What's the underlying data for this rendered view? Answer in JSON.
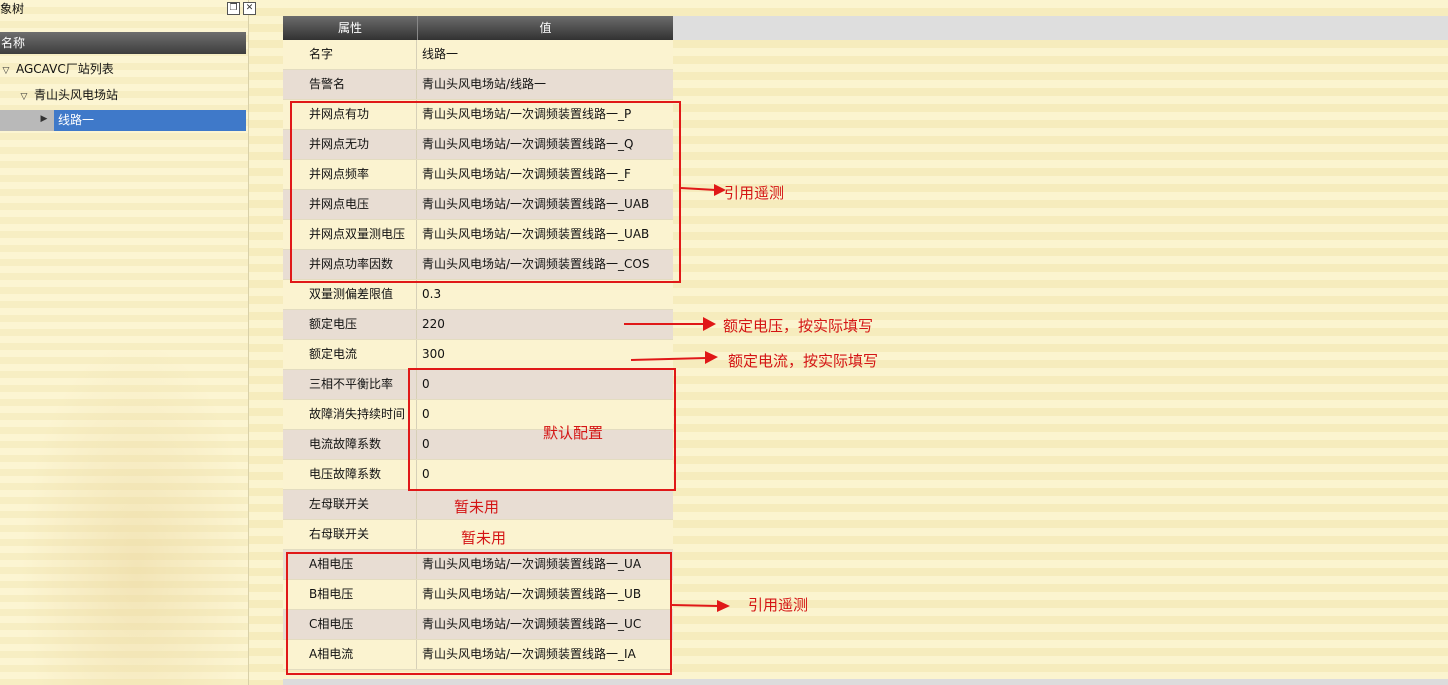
{
  "left_panel": {
    "title": "象树",
    "column_header": "名称",
    "tree": [
      {
        "label": "AGCAVC厂站列表",
        "expanded": true
      },
      {
        "label": "青山头风电场站",
        "expanded": true
      },
      {
        "label": "线路一",
        "selected": true
      }
    ]
  },
  "table": {
    "headers": [
      "属性",
      "值"
    ],
    "rows": [
      {
        "name": "名字",
        "value": "线路一"
      },
      {
        "name": "告警名",
        "value": "青山头风电场站/线路一"
      },
      {
        "name": "并网点有功",
        "value": "青山头风电场站/一次调频装置线路一_P"
      },
      {
        "name": "并网点无功",
        "value": "青山头风电场站/一次调频装置线路一_Q"
      },
      {
        "name": "并网点频率",
        "value": "青山头风电场站/一次调频装置线路一_F"
      },
      {
        "name": "并网点电压",
        "value": "青山头风电场站/一次调频装置线路一_UAB"
      },
      {
        "name": "并网点双量测电压",
        "value": "青山头风电场站/一次调频装置线路一_UAB"
      },
      {
        "name": "并网点功率因数",
        "value": "青山头风电场站/一次调频装置线路一_COS"
      },
      {
        "name": "双量测偏差限值",
        "value": "0.3"
      },
      {
        "name": "额定电压",
        "value": "220"
      },
      {
        "name": "额定电流",
        "value": "300"
      },
      {
        "name": "三相不平衡比率",
        "value": "0"
      },
      {
        "name": "故障消失持续时间",
        "value": "0"
      },
      {
        "name": "电流故障系数",
        "value": "0"
      },
      {
        "name": "电压故障系数",
        "value": "0"
      },
      {
        "name": "左母联开关",
        "value": ""
      },
      {
        "name": "右母联开关",
        "value": ""
      },
      {
        "name": "A相电压",
        "value": "青山头风电场站/一次调频装置线路一_UA"
      },
      {
        "name": "B相电压",
        "value": "青山头风电场站/一次调频装置线路一_UB"
      },
      {
        "name": "C相电压",
        "value": "青山头风电场站/一次调频装置线路一_UC"
      },
      {
        "name": "A相电流",
        "value": "青山头风电场站/一次调频装置线路一_IA"
      }
    ]
  },
  "annotations": {
    "ref_telemetry_1": "引用遥测",
    "rated_voltage": "额定电压，按实际填写",
    "rated_current": "额定电流，按实际填写",
    "default_config": "默认配置",
    "unused_1": "暂未用",
    "unused_2": "暂未用",
    "ref_telemetry_2": "引用遥测"
  },
  "colors": {
    "annotation_red": "#e01818",
    "selection_blue": "#3f79c9"
  }
}
